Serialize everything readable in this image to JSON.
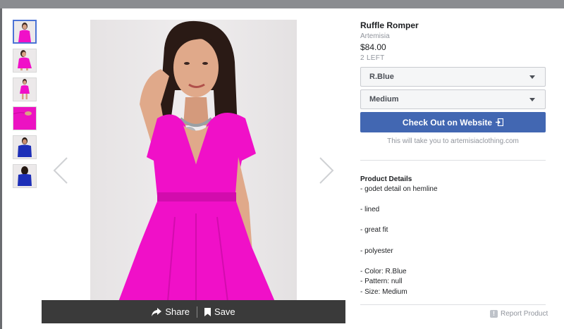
{
  "colors": {
    "accent": "#4267b2",
    "dress": "#f010c8",
    "thumb_active": "#4c73d6"
  },
  "gallery": {
    "thumbnails": [
      {
        "name": "thumb-front",
        "variant": "pink"
      },
      {
        "name": "thumb-side",
        "variant": "pink"
      },
      {
        "name": "thumb-back",
        "variant": "pink"
      },
      {
        "name": "thumb-fabric",
        "variant": "pink"
      },
      {
        "name": "thumb-blue-front",
        "variant": "blue"
      },
      {
        "name": "thumb-blue-back",
        "variant": "blue"
      }
    ],
    "prev_icon": "chevron-left-icon",
    "next_icon": "chevron-right-icon"
  },
  "actions": {
    "share_label": "Share",
    "save_label": "Save"
  },
  "product": {
    "title": "Ruffle Romper",
    "brand": "Artemisia",
    "price": "$84.00",
    "stock": "2 LEFT"
  },
  "selects": {
    "color": "R.Blue",
    "size": "Medium"
  },
  "checkout": {
    "label": "Check Out on Website",
    "note": "This will take you to artemisiaclothing.com"
  },
  "details": {
    "heading": "Product Details",
    "lines": [
      "- godet detail on hemline",
      "",
      "- lined",
      "",
      "- great fit",
      "",
      "- polyester",
      "",
      "- Color: R.Blue",
      "- Pattern: null",
      "- Size: Medium"
    ]
  },
  "report": {
    "label": "Report Product"
  }
}
